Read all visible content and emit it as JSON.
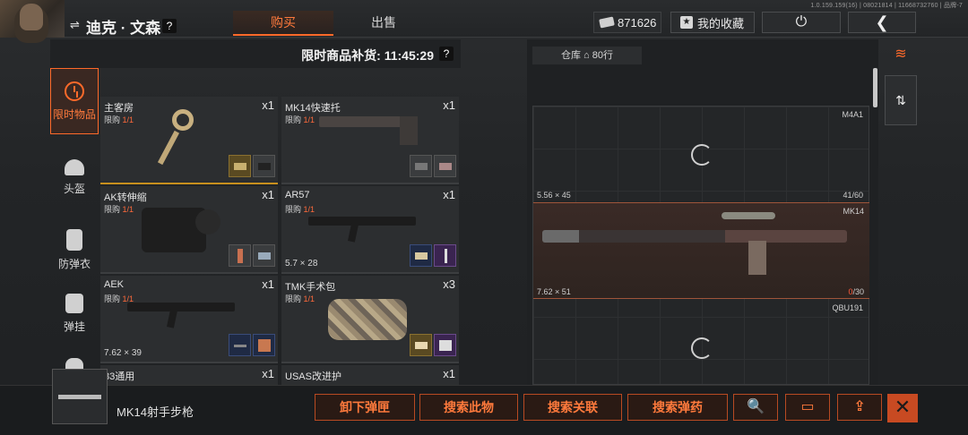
{
  "version": "1.0.159.159(16) | 08021814 | 11668732760 | 品牌-7",
  "player": {
    "name": "迪克 · 文森",
    "help": "?"
  },
  "tabs": [
    {
      "label": "购买"
    },
    {
      "label": "出售"
    }
  ],
  "currency": {
    "amount": "871626"
  },
  "favorites_label": "我的收藏",
  "restock": {
    "label": "限时商品补货: 11:45:29",
    "help": "?"
  },
  "categories": [
    {
      "label": "限时物品"
    },
    {
      "label": "头盔"
    },
    {
      "label": "防弹衣"
    },
    {
      "label": "弹挂"
    }
  ],
  "shop_items": [
    {
      "name": "主客房",
      "qty": "x1",
      "limit_label": "限购",
      "limit": "1/1",
      "caliber": ""
    },
    {
      "name": "MK14快速托",
      "qty": "x1",
      "limit_label": "限购",
      "limit": "1/1",
      "caliber": ""
    },
    {
      "name": "AK转伸缩",
      "qty": "x1",
      "limit_label": "限购",
      "limit": "1/1",
      "caliber": ""
    },
    {
      "name": "AR57",
      "qty": "x1",
      "limit_label": "限购",
      "limit": "1/1",
      "caliber": "5.7 × 28"
    },
    {
      "name": "AEK",
      "qty": "x1",
      "limit_label": "限购",
      "limit": "1/1",
      "caliber": "7.62 × 39"
    },
    {
      "name": "TMK手术包",
      "qty": "x3",
      "limit_label": "限购",
      "limit": "1/1",
      "caliber": ""
    },
    {
      "name": "83通用",
      "qty": "x1",
      "limit_label": "",
      "limit": "",
      "caliber": ""
    },
    {
      "name": "USAS改进护",
      "qty": "x1",
      "limit_label": "",
      "limit": "",
      "caliber": ""
    }
  ],
  "stash": {
    "label": "仓库",
    "rows": "80行",
    "slots": [
      {
        "name": "M4A1",
        "caliber": "5.56 × 45",
        "ammo": "41/60"
      },
      {
        "name": "MK14",
        "caliber": "7.62 × 51",
        "ammo_current": "0",
        "ammo_max": "/30"
      },
      {
        "name": "QBU191"
      }
    ]
  },
  "selected_item": {
    "name": "MK14射手步枪"
  },
  "actions": [
    {
      "label": "卸下弹匣"
    },
    {
      "label": "搜索此物"
    },
    {
      "label": "搜索关联"
    },
    {
      "label": "搜索弹药"
    }
  ],
  "icons": {
    "search": "🔍",
    "power": "⏻",
    "back": "❮",
    "close": "✕",
    "swap": "⇌",
    "star": "★",
    "layers": "≋",
    "sort": "⇅",
    "fold": "▭",
    "upgrade": "⇪"
  },
  "colors": {
    "accent": "#ff6a2a",
    "accent_bg": "#2a1a14"
  }
}
